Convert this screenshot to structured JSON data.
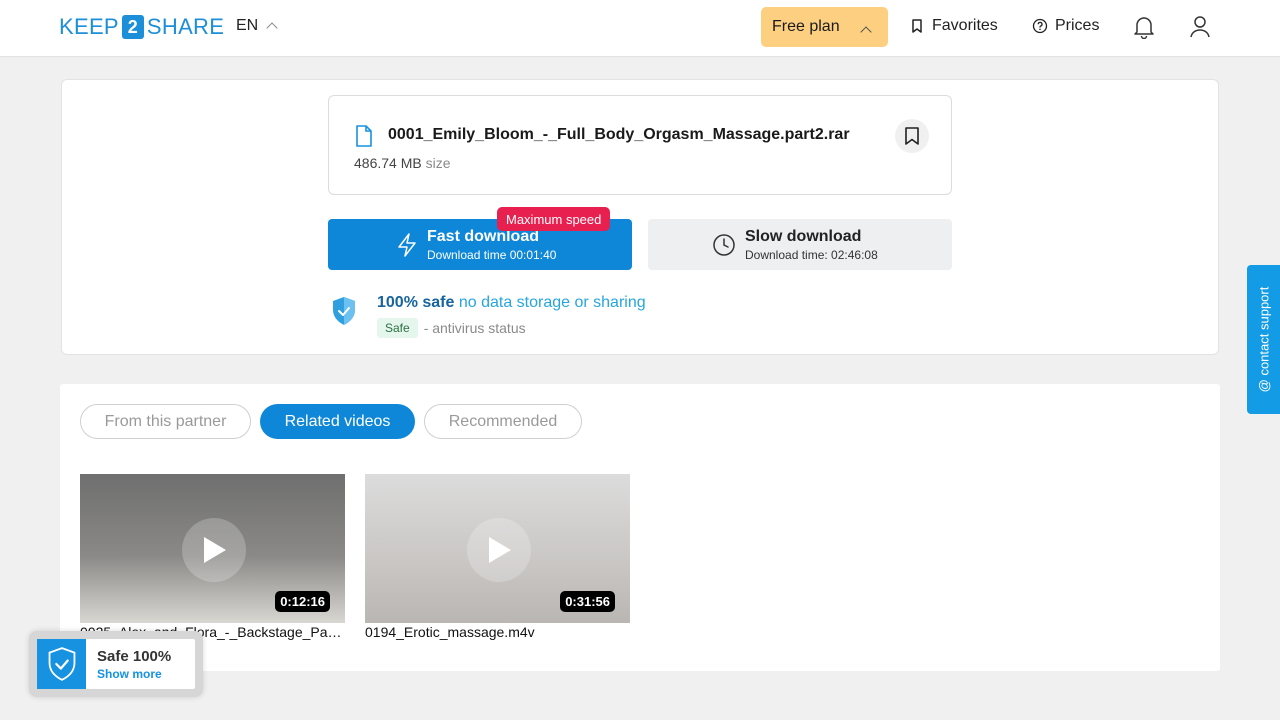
{
  "header": {
    "logo_left": "KEEP",
    "logo_mid": "2",
    "logo_right": "SHARE",
    "lang": "EN",
    "plan": "Free plan",
    "favorites": "Favorites",
    "prices": "Prices"
  },
  "file": {
    "name": "0001_Emily_Bloom_-_Full_Body_Orgasm_Massage.part2.rar",
    "size": "486.74 MB",
    "size_label": "size"
  },
  "download": {
    "fast_title": "Fast download",
    "fast_time": "Download time 00:01:40",
    "max_speed": "Maximum speed",
    "slow_title": "Slow download",
    "slow_time": "Download time: 02:46:08"
  },
  "safety": {
    "bold": "100% safe",
    "rest": "no data storage or sharing",
    "badge": "Safe",
    "status": "- antivirus status"
  },
  "tabs": [
    "From this partner",
    "Related videos",
    "Recommended"
  ],
  "videos": [
    {
      "title": "0025_Alex_and_Flora_-_Backstage_Pas...",
      "duration": "0:12:16"
    },
    {
      "title": "0194_Erotic_massage.m4v",
      "duration": "0:31:56"
    }
  ],
  "support": "@ contact support",
  "widget": {
    "title": "Safe 100%",
    "link": "Show more"
  },
  "colors": {
    "primary": "#0f87d8",
    "plan": "#fcd080",
    "badge_red": "#e8204f"
  }
}
